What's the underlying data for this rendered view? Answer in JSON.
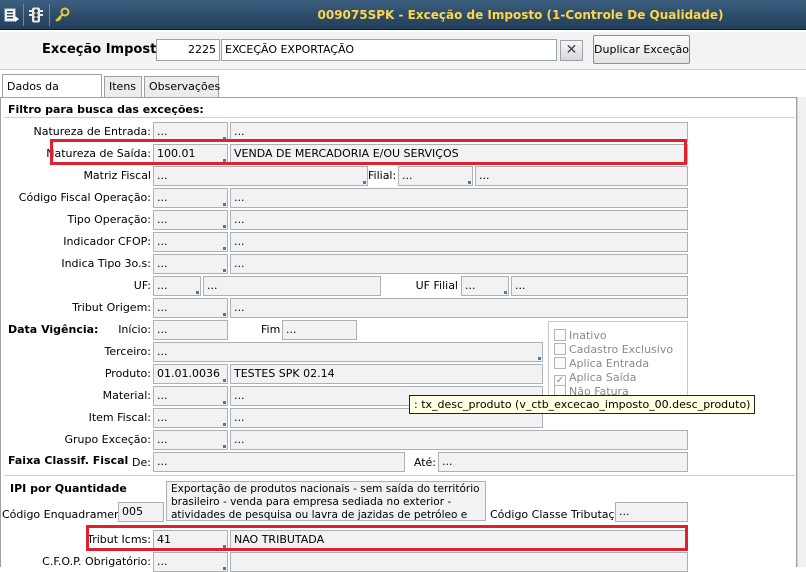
{
  "window": {
    "title": "009075SPK - Exceção de Imposto (1-Controle De Qualidade)",
    "toolbar_icons": [
      "list-icon",
      "traffic-light-icon",
      "key-icon"
    ]
  },
  "header": {
    "label": "Exceção Imposto",
    "code": "2225",
    "description": "EXCEÇÃO EXPORTAÇÃO",
    "clear_symbol": "✕",
    "duplicate_button": "Duplicar Exceção"
  },
  "tabs": [
    {
      "label": "Dados da Exceção",
      "active": true
    },
    {
      "label": "Itens",
      "active": false
    },
    {
      "label": "Observações",
      "active": false
    }
  ],
  "filter": {
    "section_title": "Filtro para busca das exceções:",
    "natureza_entrada": {
      "label": "Natureza de Entrada:",
      "code": "...",
      "desc": "..."
    },
    "natureza_saida": {
      "label": "Natureza de Saída:",
      "code": "100.01",
      "desc": "VENDA DE MERCADORIA E/OU SERVIÇOS"
    },
    "matriz_fiscal": {
      "label": "Matriz Fiscal",
      "value": "..."
    },
    "filial": {
      "label": "Filial:",
      "code": "...",
      "desc": "..."
    },
    "codigo_fiscal_operacao": {
      "label": "Código Fiscal Operação:",
      "code": "...",
      "desc": "..."
    },
    "tipo_operacao": {
      "label": "Tipo Operação:",
      "code": "...",
      "desc": "..."
    },
    "indicador_cfop": {
      "label": "Indicador CFOP:",
      "code": "...",
      "desc": "..."
    },
    "indica_tipo_3os": {
      "label": "Indica Tipo 3o.s:",
      "code": "...",
      "desc": "..."
    },
    "uf": {
      "label": "UF:",
      "code": "...",
      "desc": "..."
    },
    "uf_filial": {
      "label": "UF Filial",
      "code": "...",
      "desc": "..."
    },
    "tribut_origem": {
      "label": "Tribut Origem:",
      "code": "...",
      "desc": "..."
    }
  },
  "vigencia": {
    "section_title": "Data Vigência:",
    "inicio_label": "Início:",
    "inicio": "...",
    "fim_label": "Fim",
    "fim": "..."
  },
  "details": {
    "terceiro": {
      "label": "Terceiro:",
      "value": "..."
    },
    "produto": {
      "label": "Produto:",
      "code": "01.01.0036",
      "desc": "TESTES SPK 02.14"
    },
    "material": {
      "label": "Material:",
      "code": "...",
      "desc": "..."
    },
    "item_fiscal": {
      "label": "Item Fiscal:",
      "code": "...",
      "desc": "..."
    },
    "grupo_excecao": {
      "label": "Grupo Exceção:",
      "code": "...",
      "desc": "..."
    }
  },
  "checkboxes": [
    {
      "label": "Inativo",
      "checked": false
    },
    {
      "label": "Cadastro Exclusivo",
      "checked": false
    },
    {
      "label": "Aplica Entrada",
      "checked": false
    },
    {
      "label": "Aplica Saída",
      "checked": true
    },
    {
      "label": "Não Fatura",
      "checked": false
    }
  ],
  "tooltip": ": tx_desc_produto (v_ctb_excecao_imposto_00.desc_produto)",
  "faixa": {
    "section_title": "Faixa Classif. Fiscal",
    "de_label": "De:",
    "de": "...",
    "ate_label": "Até:",
    "ate": "..."
  },
  "ipi": {
    "section_title": "IPI por Quantidade",
    "codigo_enquadramento_label": "Código Enquadramento",
    "codigo_enquadramento": "005",
    "enquadramento_desc": "Exportação de produtos nacionais - sem saída do território brasileiro - venda para empresa sediada no exterior - atividades de pesquisa ou lavra de jazidas de petróleo e de gás natural -",
    "codigo_classe_label": "Código Classe Tributação",
    "codigo_classe": "..."
  },
  "icms": {
    "tribut_icms": {
      "label": "Tribut Icms:",
      "code": "41",
      "desc": "NAO TRIBUTADA"
    },
    "cfop_obrigatorio": {
      "label": "C.F.O.P. Obrigatório:",
      "code": "...",
      "desc": ""
    }
  },
  "colors": {
    "highlight": "#e0202a",
    "title_text": "#ffd64a",
    "titlebar": "#2b4a68"
  }
}
